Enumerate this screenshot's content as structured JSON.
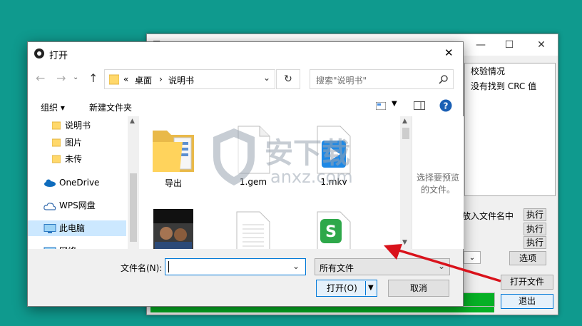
{
  "background_window": {
    "title_glyph": "■",
    "controls": {
      "minimize": "—",
      "maximize": "☐",
      "close": "✕"
    },
    "results_list": [
      "校验情况",
      "没有找到 CRC 值"
    ],
    "option_label": "放入文件名中",
    "execute_buttons": [
      "执行",
      "执行",
      "执行"
    ],
    "options_button": "选项",
    "open_file_button": "打开文件",
    "exit_button": "退出"
  },
  "dialog": {
    "title": "打开",
    "close_glyph": "✕",
    "nav": {
      "back": "←",
      "forward": "→",
      "up": "↑",
      "dropdown": "⌄",
      "refresh": "↻"
    },
    "breadcrumb": {
      "chevron": "«",
      "parts": [
        "桌面",
        "说明书"
      ],
      "sep": "›"
    },
    "search_placeholder": "搜索\"说明书\"",
    "toolbar": {
      "organize": "组织 ▾",
      "new_folder": "新建文件夹"
    },
    "nav_items": [
      {
        "label": "说明书",
        "icon": "folder-icon"
      },
      {
        "label": "图片",
        "icon": "folder-icon"
      },
      {
        "label": "未传",
        "icon": "folder-icon"
      },
      {
        "label": "OneDrive",
        "icon": "cloud-icon"
      },
      {
        "label": "WPS网盘",
        "icon": "cloud-outline-icon"
      },
      {
        "label": "此电脑",
        "icon": "computer-icon"
      },
      {
        "label": "网络",
        "icon": "network-icon"
      }
    ],
    "files": [
      {
        "name": "导出",
        "type": "folder"
      },
      {
        "name": "1.gem",
        "type": "file"
      },
      {
        "name": "1.mkv",
        "type": "video"
      },
      {
        "name": "",
        "type": "image"
      },
      {
        "name": "",
        "type": "document"
      },
      {
        "name": "",
        "type": "wps"
      }
    ],
    "preview_text": "选择要预览的文件。",
    "filename_label": "文件名(N):",
    "filename_value": "",
    "filetype_value": "所有文件",
    "open_button": "打开(O)",
    "cancel_button": "取消"
  },
  "watermark": {
    "text": "安下载",
    "sub": "anxz.com"
  },
  "colors": {
    "desktop": "#0f9a8e",
    "accent": "#0078d7",
    "arrow": "#d9121b",
    "progress": "#06b025"
  }
}
